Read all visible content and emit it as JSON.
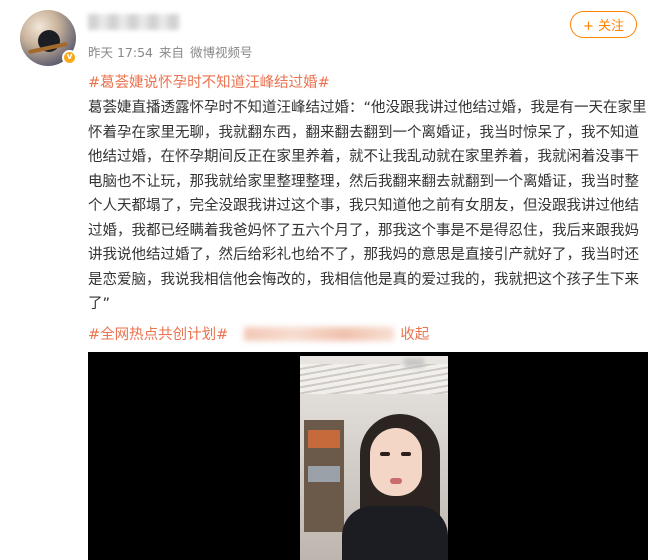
{
  "header": {
    "timestamp": "昨天 17:54",
    "source_prefix": "来自",
    "source": "微博视频号",
    "verified_badge": "v",
    "follow_label": "+ 关注"
  },
  "post": {
    "title_hashtag": "#葛荟婕说怀孕时不知道汪峰结过婚#",
    "body": "葛荟婕直播透露怀孕时不知道汪峰结过婚：“他没跟我讲过他结过婚，我是有一天在家里怀着孕在家里无聊，我就翻东西，翻来翻去翻到一个离婚证，我当时惊呆了，我不知道他结过婚，在怀孕期间反正在家里养着，就不让我乱动就在家里养着，我就闲着没事干电脑也不让玩，那我就给家里整理整理，然后我翻来翻去就翻到一个离婚证，我当时整个人天都塌了，完全没跟我讲过这个事，我只知道他之前有女朋友，但没跟我讲过他结过婚，我都已经瞒着我爸妈怀了五六个月了，那我这个事是不是得忍住，我后来跟我妈讲我说他结过婚了，然后给彩礼也给不了，那我妈的意思是直接引产就好了，我当时还是恋爱脑，我说我相信他会悔改的，我相信他是真的爱过我的，我就把这个孩子生下来了”",
    "footer_hashtag": "#全网热点共创计划#",
    "collapse_label": "收起"
  },
  "icons": {
    "avatar": "avatar-image",
    "verified": "verified-badge-icon",
    "video": "video-thumbnail"
  },
  "colors": {
    "accent": "#ff8200",
    "link": "#eb7350",
    "text": "#333333",
    "meta": "#888888"
  }
}
